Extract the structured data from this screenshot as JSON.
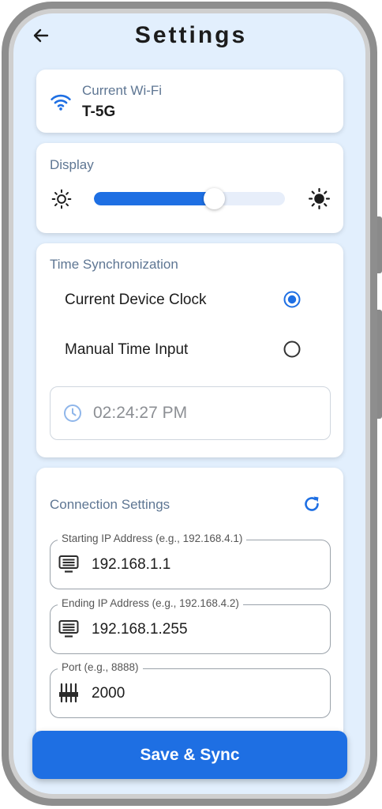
{
  "header": {
    "title": "Settings",
    "back_icon": "arrow-left-icon"
  },
  "wifi": {
    "label": "Current Wi-Fi",
    "ssid": "T-5G",
    "icon": "wifi-icon"
  },
  "display": {
    "label": "Display",
    "brightness_fraction": 0.63,
    "low_icon": "sun-outline-icon",
    "high_icon": "sun-filled-icon"
  },
  "time_sync": {
    "label": "Time Synchronization",
    "options": [
      {
        "label": "Current Device Clock",
        "selected": true
      },
      {
        "label": "Manual Time Input",
        "selected": false
      }
    ],
    "time_value": "02:24:27 PM",
    "time_icon": "clock-icon"
  },
  "connection": {
    "label": "Connection Settings",
    "refresh_icon": "refresh-icon",
    "fields": [
      {
        "label": "Starting IP Address (e.g., 192.168.4.1)",
        "value": "192.168.1.1",
        "icon": "monitor-icon"
      },
      {
        "label": "Ending IP Address (e.g., 192.168.4.2)",
        "value": "192.168.1.255",
        "icon": "monitor-icon"
      },
      {
        "label": "Port (e.g., 8888)",
        "value": "2000",
        "icon": "port-icon"
      }
    ]
  },
  "actions": {
    "save_label": "Save & Sync"
  },
  "colors": {
    "accent": "#1e6fe3",
    "background": "#e2effd",
    "card": "#ffffff"
  }
}
